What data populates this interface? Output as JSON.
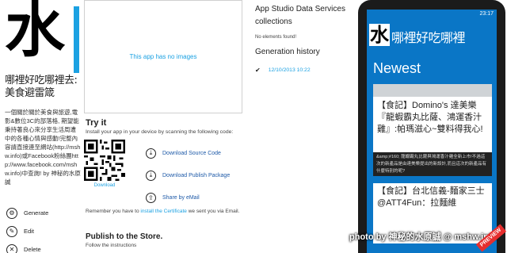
{
  "app": {
    "logo_char": "水",
    "title": "哪裡好吃哪裡去:美食避雷箴",
    "description": "一個關於關於美食與旅遊,電影&數位3C的部落格, 期望能秉持著良心來分享生活周遭中的各種心情與感動!完整內容請直接連至網站(http://mshw.info)或Facebook粉絲團http://www.facebook.com/mshw.info)中查詢! by 神秘的水原誠"
  },
  "actions": [
    {
      "label": "Generate",
      "icon": "gear-icon",
      "glyph": "⚙"
    },
    {
      "label": "Edit",
      "icon": "pencil-icon",
      "glyph": "✎"
    },
    {
      "label": "Delete",
      "icon": "trash-icon",
      "glyph": "🗑"
    }
  ],
  "preview": {
    "empty_text": "This app has no images"
  },
  "try_it": {
    "title": "Try it",
    "subtitle": "Install your app in your device by scanning the following code:",
    "qr_label": "Download",
    "downloads": [
      {
        "label": "Download Source Code",
        "icon": "download-icon",
        "glyph": "⤓"
      },
      {
        "label": "Download Publish Package",
        "icon": "download-icon",
        "glyph": "⤓"
      },
      {
        "label": "Share by eMail",
        "icon": "share-icon",
        "glyph": "⇪"
      }
    ],
    "remember_prefix": "Remember you have to ",
    "remember_link": "install the Certificate",
    "remember_suffix": " we sent you via Email."
  },
  "publish": {
    "title": "Publish to the Store.",
    "subtitle": "Follow the instructions"
  },
  "data_services": {
    "title": "App Studio Data Services collections",
    "empty": "No elements found!"
  },
  "generation": {
    "title": "Generation history",
    "entries": [
      {
        "date": "12/10/2013 10:22"
      }
    ]
  },
  "phone": {
    "status_time": "23:17",
    "logo_char": "水",
    "title": "哪裡好吃哪裡",
    "section": "Newest",
    "card1_title": "【食記】Domino's 達美樂『龍蝦霸丸比薩、鴻運香汁雞』:帕瑪滋心~雙料得我心!",
    "card1_excerpt": "&amp;#160; 龍蝦霸丸比薩與鴻運香汁雞全新上市!不過這次的新產品是由達美樂提出的新設計,而且這次的新產品有什麼特別的呢?",
    "card2_title": "【食記】台北信義-麵家三士@ATT4Fun：拉麵維"
  },
  "watermark": "photo by 神秘的水原誠 @ mshw.info",
  "badge": "PREVIEW",
  "colors": {
    "accent": "#1ba1e2",
    "phone_bg": "#0a76c6",
    "link": "#1e5aa8"
  }
}
